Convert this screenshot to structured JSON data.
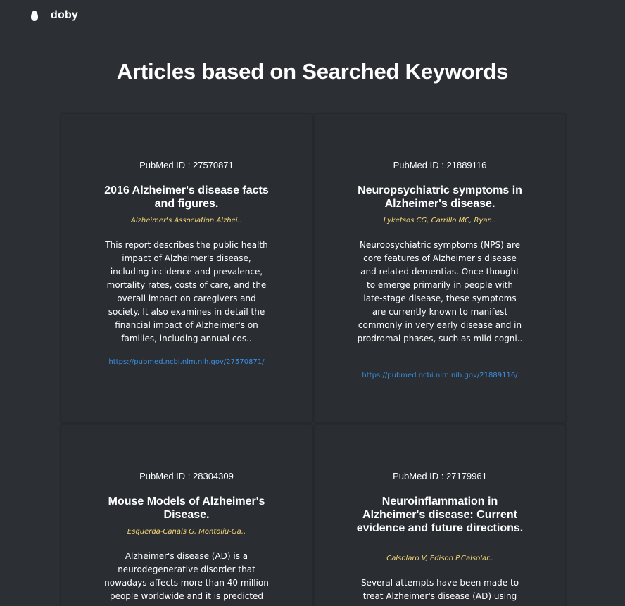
{
  "nav": {
    "brand": "doby",
    "logo_icon": "egg-icon"
  },
  "page": {
    "title": "Articles based on Searched Keywords"
  },
  "colors": {
    "background": "#2c3035",
    "card": "#2a2e33",
    "authors": "#f7d774",
    "link": "#3a8dde"
  },
  "articles": [
    {
      "pmid_label": "PubMed ID",
      "pmid": "27570871",
      "title": "2016 Alzheimer's disease facts and figures.",
      "authors": "Alzheimer's Association.Alzhei..",
      "abstract": "This report describes the public health impact of Alzheimer's disease, including incidence and prevalence, mortality rates, costs of care, and the overall impact on caregivers and society. It also examines in detail the financial impact of Alzheimer's on families, including annual cos..",
      "link": "https://pubmed.ncbi.nlm.nih.gov/27570871/"
    },
    {
      "pmid_label": "PubMed ID",
      "pmid": "21889116",
      "title": "Neuropsychiatric symptoms in Alzheimer's disease.",
      "authors": "Lyketsos CG, Carrillo MC, Ryan..",
      "abstract": "Neuropsychiatric symptoms (NPS) are core features of Alzheimer's disease and related dementias. Once thought to emerge primarily in people with late-stage disease, these symptoms are currently known to manifest commonly in very early disease and in prodromal phases, such as mild cogni..",
      "link": "https://pubmed.ncbi.nlm.nih.gov/21889116/"
    },
    {
      "pmid_label": "PubMed ID",
      "pmid": "28304309",
      "title": "Mouse Models of Alzheimer's Disease.",
      "authors": "Esquerda-Canals G, Montoliu-Ga..",
      "abstract": "Alzheimer's disease (AD) is a neurodegenerative disorder that nowadays affects more than 40 million people worldwide and it is predicted"
    },
    {
      "pmid_label": "PubMed ID",
      "pmid": "27179961",
      "title": "Neuroinflammation in Alzheimer's disease: Current evidence and future directions.",
      "authors": "Calsolaro V, Edison P.Calsolar..",
      "abstract": "Several attempts have been made to treat Alzheimer's disease (AD) using"
    }
  ]
}
